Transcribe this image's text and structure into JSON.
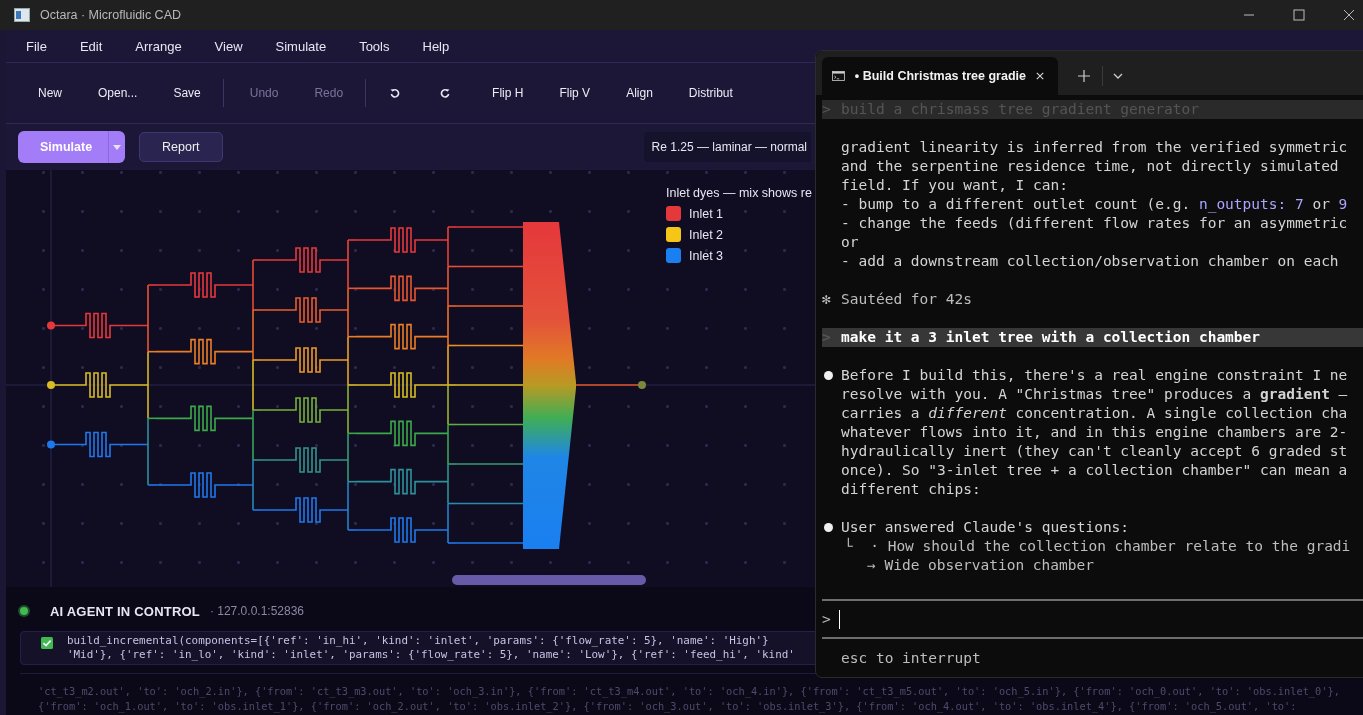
{
  "window": {
    "title": "Octara · Microfluidic CAD"
  },
  "menu": [
    "File",
    "Edit",
    "Arrange",
    "View",
    "Simulate",
    "Tools",
    "Help"
  ],
  "toolbar": [
    {
      "kind": "button",
      "label": "New",
      "disabled": false
    },
    {
      "kind": "button",
      "label": "Open...",
      "disabled": false
    },
    {
      "kind": "button",
      "label": "Save",
      "disabled": false
    },
    {
      "kind": "separator"
    },
    {
      "kind": "button",
      "label": "Undo",
      "disabled": true
    },
    {
      "kind": "button",
      "label": "Redo",
      "disabled": true
    },
    {
      "kind": "separator"
    },
    {
      "kind": "rotate-left",
      "disabled": false
    },
    {
      "kind": "rotate-right",
      "disabled": false
    },
    {
      "kind": "button",
      "label": "Flip H",
      "disabled": false
    },
    {
      "kind": "button",
      "label": "Flip V",
      "disabled": false
    },
    {
      "kind": "button",
      "label": "Align",
      "disabled": false
    },
    {
      "kind": "button",
      "label": "Distribut",
      "disabled": false
    }
  ],
  "sim_bar": {
    "simulate": "Simulate",
    "report": "Report",
    "status": "Re 1.25 — laminar — normal"
  },
  "legend": {
    "title": "Inlet dyes — mix shows re",
    "items": [
      {
        "label": "Inlet 1",
        "color": "#e5383b"
      },
      {
        "label": "Inlet 2",
        "color": "#f5c518"
      },
      {
        "label": "Inlet 3",
        "color": "#1a7ff0"
      }
    ]
  },
  "agent": {
    "label": "AI AGENT IN CONTROL",
    "address": "· 127.0.0.1:52836",
    "connected": true,
    "log": {
      "done": true,
      "lines": [
        "build_incremental(components=[{'ref': 'in_hi', 'kind': 'inlet', 'params': {'flow_rate': 5}, 'name': 'High'}",
        "'Mid'}, {'ref': 'in_lo', 'kind': 'inlet', 'params': {'flow_rate': 5}, 'name': 'Low'}, {'ref': 'feed_hi', 'kind'"
      ]
    },
    "history": [
      "'ct_t3_m2.out', 'to': 'och_2.in'}, {'from': 'ct_t3_m3.out', 'to': 'och_3.in'}, {'from': 'ct_t3_m4.out', 'to': 'och_4.in'}, {'from': 'ct_t3_m5.out', 'to': 'och_5.in'}, {'from': 'och_0.out', 'to': 'obs.inlet_0'},",
      "{'from': 'och_1.out', 'to': 'obs.inlet_1'}, {'from': 'och_2.out', 'to': 'obs.inlet_2'}, {'from': 'och_3.out', 'to': 'obs.inlet_3'}, {'from': 'och_4.out', 'to': 'obs.inlet_4'}, {'from': 'och_5.out', 'to':"
    ]
  },
  "terminal": {
    "tab": {
      "title": "• Build Christmas tree gradie",
      "selected": true
    },
    "blocks": [
      {
        "kind": "prompt",
        "glyph": ">",
        "dim": true,
        "text": "build a chrismass tree gradient generator"
      },
      {
        "kind": "text",
        "lines": [
          [
            {
              "text": "gradient linearity is inferred from the verified symmetric",
              "code": false
            }
          ],
          [
            {
              "text": "and the serpentine residence time, not directly simulated",
              "code": false
            }
          ],
          [
            {
              "text": "field. If you want, I can:",
              "code": false
            }
          ],
          [
            {
              "text": "- bump to a different outlet count (e.g. ",
              "code": false
            },
            {
              "text": "n_outputs: 7",
              "code": true
            },
            {
              "text": " or ",
              "code": false
            },
            {
              "text": "9",
              "code": true
            }
          ],
          [
            {
              "text": "- change the feeds (different flow rates for an asymmetric",
              "code": false
            }
          ],
          [
            {
              "text": "or",
              "code": false
            }
          ],
          [
            {
              "text": "- add a downstream collection/observation chamber on each",
              "code": false
            }
          ]
        ]
      },
      {
        "kind": "status",
        "glyph": "✻",
        "text": "Sautéed for 42s"
      },
      {
        "kind": "prompt",
        "glyph": ">",
        "dim": false,
        "text": "make it a 3 inlet tree with a collection chamber"
      },
      {
        "kind": "bullet",
        "lines": [
          "Before I build this, there's a real engine constraint I ne",
          "resolve with you. A \"Christmas tree\" produces a **gradient** —",
          "carries a *different* concentration. A single collection cha",
          "whatever flows into it, and in this engine chambers are 2-",
          "hydraulically inert (they can't cleanly accept 6 graded st",
          "once). So \"3-inlet tree + a collection chamber\" can mean a",
          "different chips:"
        ]
      },
      {
        "kind": "bullet",
        "lines": [
          "User answered Claude's questions:"
        ],
        "replies": [
          "└  · How should the collection chamber relate to the gradi",
          "→ Wide observation chamber"
        ]
      }
    ],
    "input": {
      "glyph": ">"
    },
    "footer": "esc to interrupt"
  }
}
